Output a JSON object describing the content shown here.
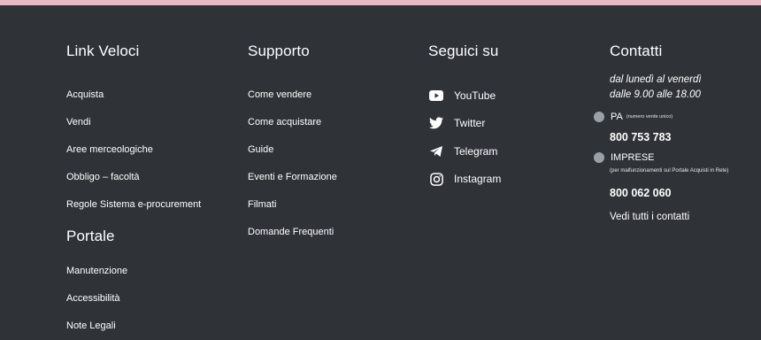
{
  "columns": {
    "quick_links": {
      "title": "Link Veloci",
      "items": [
        "Acquista",
        "Vendi",
        "Aree merceologiche",
        "Obbligo – facoltà",
        "Regole Sistema e-procurement"
      ]
    },
    "portale": {
      "title": "Portale",
      "items": [
        "Manutenzione",
        "Accessibilità",
        "Note Legali"
      ]
    },
    "support": {
      "title": "Supporto",
      "items": [
        "Come vendere",
        "Come acquistare",
        "Guide",
        "Eventi e Formazione",
        "Filmati",
        "Domande Frequenti"
      ]
    },
    "social": {
      "title": "Seguici su",
      "items": [
        {
          "label": "YouTube",
          "icon": "youtube-icon"
        },
        {
          "label": "Twitter",
          "icon": "twitter-icon"
        },
        {
          "label": "Telegram",
          "icon": "telegram-icon"
        },
        {
          "label": "Instagram",
          "icon": "instagram-icon"
        }
      ]
    },
    "contacts": {
      "title": "Contatti",
      "hours_line1": "dal lunedì al venerdì",
      "hours_line2": "dalle 9.00 alle 18.00",
      "pa_label": "PA",
      "pa_note": "(numero verde unico)",
      "pa_phone": "800 753 783",
      "imprese_label": "IMPRESE",
      "imprese_note": "(per malfunzionamenti sul Portale Acquisti in Rete)",
      "imprese_phone": "800 062 060",
      "all_contacts": "Vedi tutti i contatti"
    }
  },
  "colors": {
    "background": "#2f3338",
    "top_strip": "#e9b9c6",
    "text": "#ffffff",
    "icon_dot": "#9aa0a6"
  }
}
